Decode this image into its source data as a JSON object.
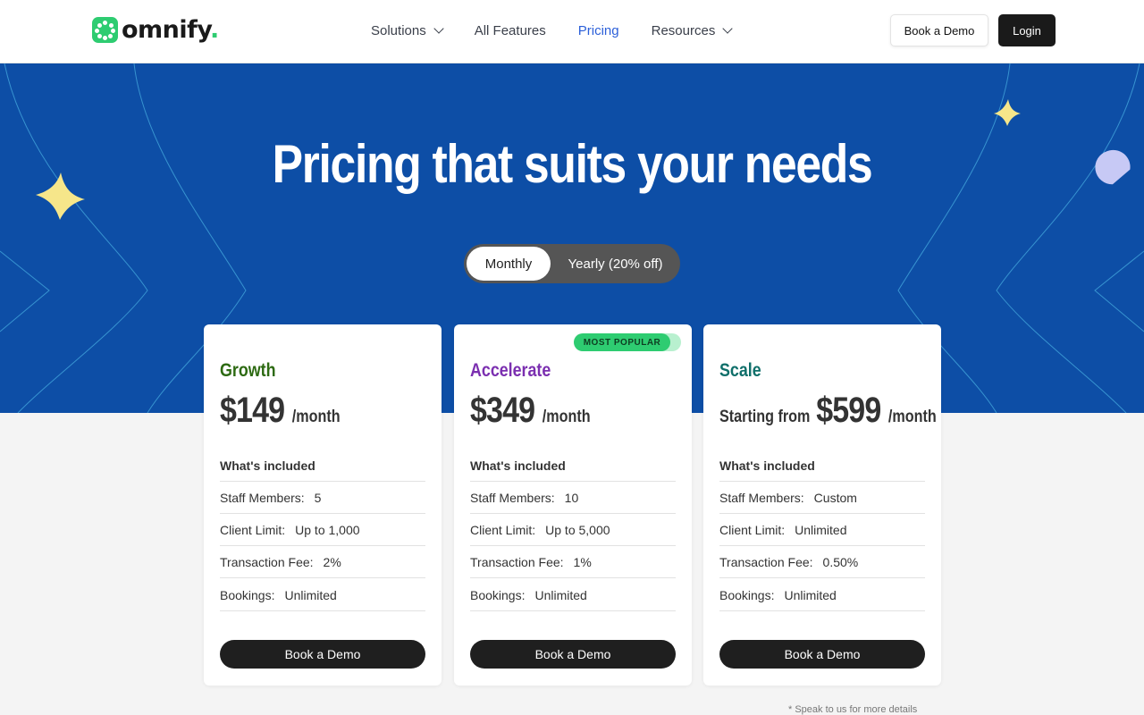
{
  "header": {
    "logo_text": "omnify",
    "logo_period": ".",
    "nav": [
      "Solutions",
      "All Features",
      "Pricing",
      "Resources"
    ],
    "book_demo": "Book a Demo",
    "login": "Login"
  },
  "hero": {
    "title": "Pricing that suits your needs",
    "toggle_monthly": "Monthly",
    "toggle_yearly": "Yearly (20% off)"
  },
  "cards": [
    {
      "name": "Growth",
      "name_color": "#2d6a12",
      "price_prefix": "",
      "price": "$149",
      "per": "/month",
      "included": "What's included",
      "features": [
        {
          "label": "Staff Members:",
          "value": "5"
        },
        {
          "label": "Client Limit:",
          "value": "Up to 1,000"
        },
        {
          "label": "Transaction Fee:",
          "value": "2%"
        },
        {
          "label": "Bookings:",
          "value": "Unlimited"
        }
      ],
      "button": "Book a Demo"
    },
    {
      "name": "Accelerate",
      "name_color": "#7b2fb0",
      "badge": "MOST POPULAR",
      "price_prefix": "",
      "price": "$349",
      "per": "/month",
      "included": "What's included",
      "features": [
        {
          "label": "Staff Members:",
          "value": "10"
        },
        {
          "label": "Client Limit:",
          "value": "Up to 5,000"
        },
        {
          "label": "Transaction Fee:",
          "value": "1%"
        },
        {
          "label": "Bookings:",
          "value": "Unlimited"
        }
      ],
      "button": "Book a Demo"
    },
    {
      "name": "Scale",
      "name_color": "#0f6f6a",
      "price_prefix": "Starting from",
      "price": "$599",
      "per": "/month",
      "included": "What's included",
      "features": [
        {
          "label": "Staff Members:",
          "value": "Custom"
        },
        {
          "label": "Client Limit:",
          "value": "Unlimited"
        },
        {
          "label": "Transaction Fee:",
          "value": "0.50%"
        },
        {
          "label": "Bookings:",
          "value": "Unlimited"
        }
      ],
      "button": "Book a Demo"
    }
  ],
  "footnote": "* Speak to us for more details",
  "colors": {
    "hero_bg": "#0d4ea6",
    "accent_green": "#2ecc71",
    "active_nav": "#2b5fd9",
    "star_yellow": "#f6e68a"
  }
}
